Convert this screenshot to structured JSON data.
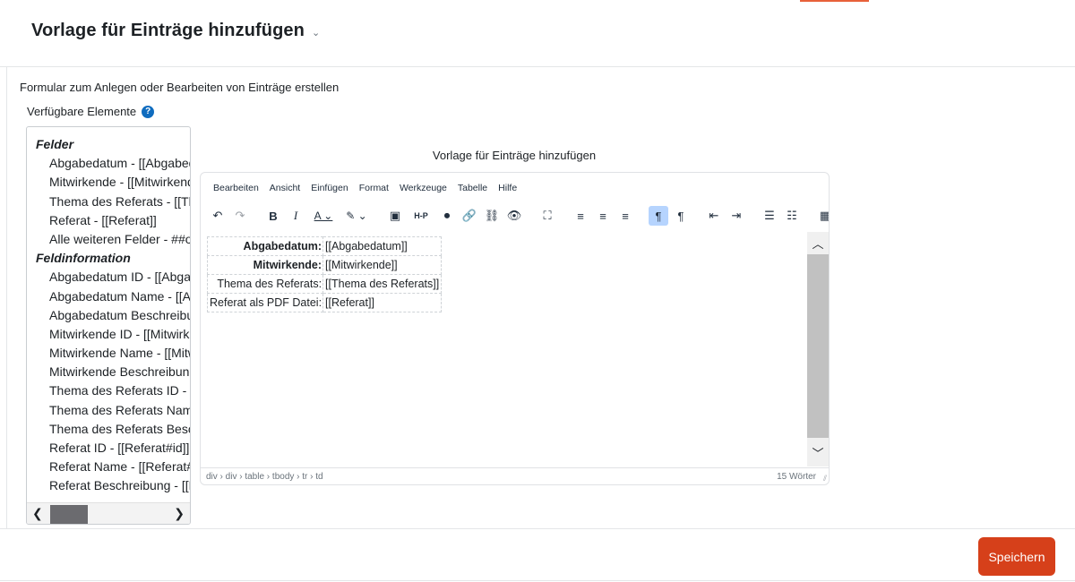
{
  "header": {
    "title": "Vorlage für Einträge hinzufügen",
    "chevron": "⌄"
  },
  "form": {
    "description": "Formular zum Anlegen oder Bearbeiten von Einträge erstellen",
    "available_label": "Verfügbare Elemente",
    "help_icon": "?"
  },
  "fields_panel": {
    "groups": [
      {
        "title": "Felder",
        "items": [
          "Abgabedatum - [[Abgabedatum]]",
          "Mitwirkende - [[Mitwirkende]]",
          "Thema des Referats - [[Thema des Referats]]",
          "Referat - [[Referat]]",
          "Alle weiteren Felder - ##otherfields##"
        ]
      },
      {
        "title": "Feldinformation",
        "items": [
          "Abgabedatum ID - [[Abgabedatum#id]]",
          "Abgabedatum Name - [[Abgabedatum#name]]",
          "Abgabedatum Beschreibung - [[Abgabedatum#description]]",
          "Mitwirkende ID - [[Mitwirkende#id]]",
          "Mitwirkende Name - [[Mitwirkende#name]]",
          "Mitwirkende Beschreibung - [[Mitwirkende#description]]",
          "Thema des Referats ID - [[Thema des Referats#id]]",
          "Thema des Referats Name - [[Thema des Referats#name]]",
          "Thema des Referats Beschreibung - [[Thema des Referats#description]]",
          "Referat ID - [[Referat#id]]",
          "Referat Name - [[Referat#name]]",
          "Referat Beschreibung - [[Referat#description]]"
        ]
      }
    ],
    "scroll_left": "❮",
    "scroll_right": "❯"
  },
  "editor": {
    "caption": "Vorlage für Einträge hinzufügen",
    "menu": [
      "Bearbeiten",
      "Ansicht",
      "Einfügen",
      "Format",
      "Werkzeuge",
      "Tabelle",
      "Hilfe"
    ],
    "toolbar": [
      {
        "name": "undo",
        "glyph": "↶"
      },
      {
        "name": "redo",
        "glyph": "↷",
        "dim": true
      },
      {
        "name": "gap"
      },
      {
        "name": "bold",
        "glyph": "B"
      },
      {
        "name": "italic",
        "glyph": "I"
      },
      {
        "name": "text-color",
        "glyph": "A ⌄"
      },
      {
        "name": "highlight",
        "glyph": "✎ ⌄"
      },
      {
        "name": "gap"
      },
      {
        "name": "media",
        "glyph": "▣"
      },
      {
        "name": "h5p",
        "glyph": "H-P"
      },
      {
        "name": "audio",
        "glyph": "⏺"
      },
      {
        "name": "link",
        "glyph": "🔗"
      },
      {
        "name": "unlink",
        "glyph": "⛓"
      },
      {
        "name": "preview",
        "glyph": "👁"
      },
      {
        "name": "gap"
      },
      {
        "name": "fullscreen",
        "glyph": "⛶"
      },
      {
        "name": "gap"
      },
      {
        "name": "align-left",
        "glyph": "≡"
      },
      {
        "name": "align-center",
        "glyph": "≡"
      },
      {
        "name": "align-right",
        "glyph": "≡"
      },
      {
        "name": "gap"
      },
      {
        "name": "ltr",
        "glyph": "¶",
        "active": true
      },
      {
        "name": "rtl",
        "glyph": "¶"
      },
      {
        "name": "gap"
      },
      {
        "name": "outdent",
        "glyph": "⇤"
      },
      {
        "name": "indent",
        "glyph": "⇥"
      },
      {
        "name": "gap"
      },
      {
        "name": "bullet-list",
        "glyph": "☰"
      },
      {
        "name": "numbered-list",
        "glyph": "☷"
      },
      {
        "name": "gap"
      },
      {
        "name": "calculator",
        "glyph": "▦"
      }
    ],
    "rows": [
      {
        "label": "Abgabedatum:",
        "style": "red",
        "value": "[[Abgabedatum]]"
      },
      {
        "label": "Mitwirkende:",
        "style": "blue",
        "value": "[[Mitwirkende]]"
      },
      {
        "label": "Thema des Referats:",
        "style": "plain",
        "value": "[[Thema des Referats]]"
      },
      {
        "label": "Referat als PDF Datei:",
        "style": "plain",
        "value": "[[Referat]]"
      }
    ],
    "scroll_up": "︿",
    "scroll_down": "﹀",
    "statusbar": {
      "path": "div › div › table › tbody › tr › td",
      "word_count": "15 Wörter",
      "grip": "⫽"
    }
  },
  "footer": {
    "save_label": "Speichern"
  },
  "colors": {
    "accent": "#d6401a",
    "label_red": "#e02d2d",
    "label_blue": "#1f6fb5",
    "help": "#0f6cbf"
  }
}
